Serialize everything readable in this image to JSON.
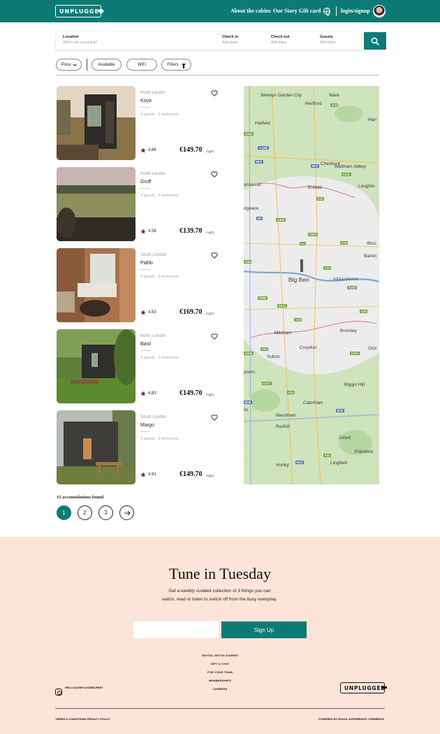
{
  "header": {
    "logo": "UNPLUGGED",
    "nav": [
      "About the cabins",
      "Our Story",
      "Gift card"
    ],
    "login": "login/signup"
  },
  "search": {
    "location_label": "Location",
    "location_placeholder": "Where are you going?",
    "checkin_label": "Check in",
    "checkin_placeholder": "Add dates",
    "checkout_label": "Check out",
    "checkout_placeholder": "Add dates",
    "guests_label": "Guests",
    "guests_placeholder": "Add dates"
  },
  "filters": {
    "price": "Price",
    "available": "Available",
    "wifi": "WiFi",
    "more": "Filters"
  },
  "listings": [
    {
      "area": "North London",
      "name": "Koya",
      "meta": "4 guests · 2 bedrooms",
      "rating": "4.86",
      "price": "€149.70",
      "unit": "/night"
    },
    {
      "area": "North London",
      "name": "Gruff",
      "meta": "4 guests · 2 bedrooms",
      "rating": "4.56",
      "price": "€139.70",
      "unit": "/night"
    },
    {
      "area": "South London",
      "name": "Pablo",
      "meta": "4 guests · 2 bedrooms",
      "rating": "4.63",
      "price": "€169.70",
      "unit": "/night"
    },
    {
      "area": "North London",
      "name": "Basil",
      "meta": "4 guests · 2 bedrooms",
      "rating": "4.83",
      "price": "€149.70",
      "unit": "/night"
    },
    {
      "area": "South London",
      "name": "Margo",
      "meta": "4 guests · 2 bedrooms",
      "rating": "4.91",
      "price": "€149.70",
      "unit": "/night"
    }
  ],
  "map": {
    "places": [
      "Welwyn Garden City",
      "Ware",
      "Hertford",
      "Harl",
      "Hatfield",
      "Cheshunt",
      "Waltham Abbey",
      "Loughto",
      "amwood",
      "Enfield",
      "dgware",
      "Ilforc",
      "Barkin",
      "Big Ben",
      "GREENWICH",
      "Mitcham",
      "Bromley",
      "Croydon",
      "Orpi",
      "Sutton",
      "psom",
      "Biggin Hill",
      "Caterham",
      "lls",
      "Merstham",
      "Redhill",
      "Oxted",
      "Edenbrid",
      "Lingfield",
      "Horley"
    ],
    "roads": [
      "A10",
      "A414",
      "A1(M)",
      "M25",
      "M25",
      "A110",
      "A10",
      "M1",
      "A406",
      "A503",
      "A12",
      "A1",
      "A40",
      "A13",
      "A102",
      "A205",
      "A214",
      "A20",
      "A23",
      "A24",
      "A240",
      "A232",
      "A217",
      "A23",
      "M25",
      "M25",
      "A22",
      "M23"
    ]
  },
  "pagination": {
    "found": "15 accomodations found",
    "pages": [
      "1",
      "2",
      "3"
    ]
  },
  "newsletter": {
    "title": "Tune in Tuesday",
    "subtitle": "Get a weekly curated collection of 3 things you can watch, read or listen to switch off from the busy everyday.",
    "button": "Sign Up"
  },
  "footer": {
    "links": [
      "DIGITAL DETOX DIARIES",
      "GIFT A STAY",
      "FOR YOUR TEAM",
      "MEMBERSHIPS",
      "CAREERS"
    ],
    "email": "HELLO@UNPLUGGED.REST",
    "logo": "UNPLUGGED",
    "legal": "TERMS & CONDITIONS PRIVACY POLICY",
    "powered": "POWERED BY EASOL EXPERIENCE COMMERCE"
  },
  "colors": {
    "brand": "#0c7b75",
    "star": "#8b1a3a",
    "footer_bg": "#fde4d8"
  }
}
